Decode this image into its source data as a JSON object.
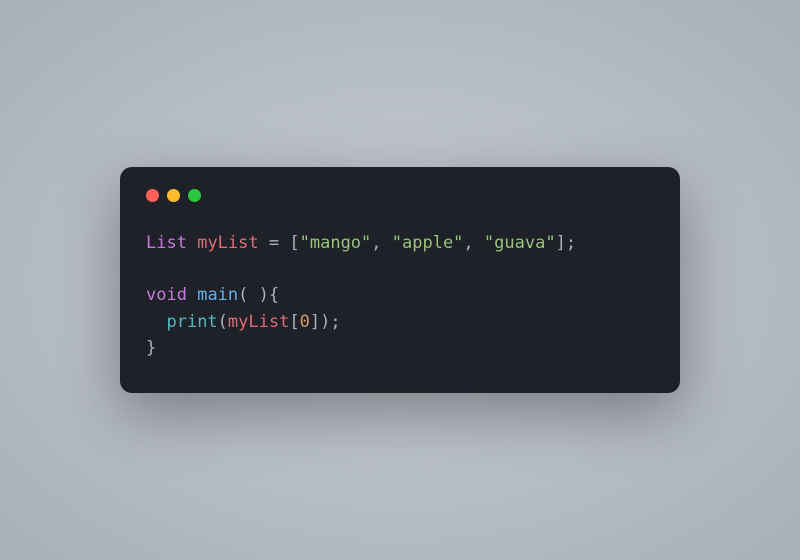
{
  "window": {
    "traffic": {
      "red": "#ff5f56",
      "yellow": "#ffbd2e",
      "green": "#27c93f"
    }
  },
  "code": {
    "line1": {
      "type_kw": "List",
      "sp1": " ",
      "var": "myList",
      "sp2": " ",
      "eq": "=",
      "sp3": " ",
      "lb": "[",
      "s1": "\"mango\"",
      "c1": ", ",
      "s2": "\"apple\"",
      "c2": ", ",
      "s3": "\"guava\"",
      "rb": "]",
      "semi": ";"
    },
    "blank": "",
    "line3": {
      "void_kw": "void",
      "sp1": " ",
      "main": "main",
      "parens": "( )",
      "brace": "{"
    },
    "line4": {
      "indent": "  ",
      "print": "print",
      "lp": "(",
      "var": "myList",
      "lb": "[",
      "idx": "0",
      "rb": "]",
      "rp": ")",
      "semi": ";"
    },
    "line5": {
      "brace": "}"
    }
  },
  "colors": {
    "bg": "#1e2127",
    "keyword": "#c678dd",
    "identifier": "#e06c75",
    "string": "#98c379",
    "function": "#61afef",
    "call": "#56b6c2",
    "number": "#d19a66",
    "punct": "#abb2bf"
  }
}
